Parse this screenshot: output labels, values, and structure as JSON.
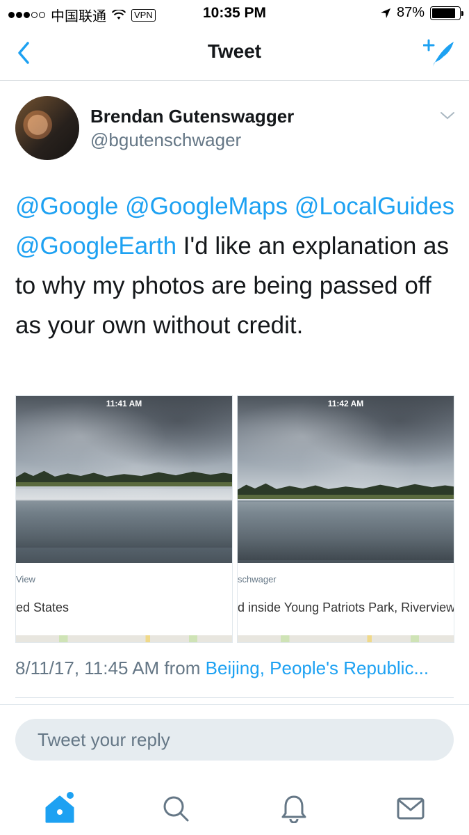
{
  "status_bar": {
    "carrier": "中国联通",
    "vpn": "VPN",
    "time": "10:35 PM",
    "battery": "87%",
    "battery_level": 0.87,
    "icons": [
      "signal-dots",
      "wifi-icon",
      "location-arrow-icon",
      "battery-icon"
    ]
  },
  "nav": {
    "title": "Tweet",
    "back_icon": "chevron-left-icon",
    "compose_icon": "compose-feather-icon"
  },
  "tweet": {
    "display_name": "Brendan Gutenswagger",
    "handle": "@bgutenschwager",
    "text_parts": {
      "m1": "@Google",
      "m2": "@GoogleMaps",
      "m3": "@LocalGuides",
      "m4": "@GoogleEarth",
      "body": " I'd like an explanation as to why my photos are being passed off as your own without credit."
    },
    "media": [
      {
        "time": "11:41 AM",
        "caption": "View",
        "place": "ed States"
      },
      {
        "time": "11:42 AM",
        "caption": "schwager",
        "place": "d inside Young Patriots Park, Riverview"
      }
    ],
    "timestamp": "8/11/17, 11:45 AM from ",
    "source": "Beijing, People's Republic..."
  },
  "reply": {
    "placeholder": "Tweet your reply"
  },
  "tabs": [
    "home-icon",
    "search-icon",
    "bell-icon",
    "mail-icon"
  ],
  "colors": {
    "accent": "#1da1f2",
    "text": "#14171a",
    "muted": "#657786",
    "reply_bg": "#e6ecf0"
  }
}
